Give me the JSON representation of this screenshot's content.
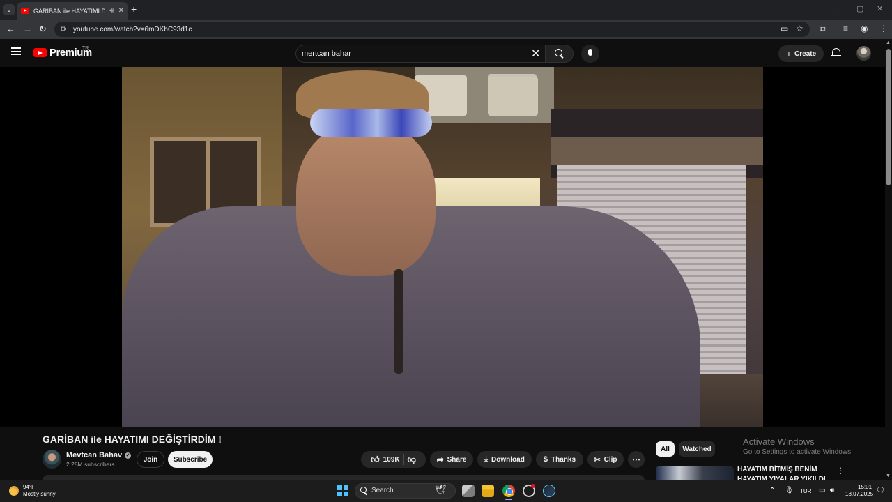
{
  "browser": {
    "tab_title": "GARİBAN ile HAYATIMI DEĞİŞTİRDİM !",
    "url": "youtube.com/watch?v=6mDKbC93d1c"
  },
  "youtube": {
    "logo_text": "Premium",
    "country": "TR",
    "search_value": "mertcan bahar",
    "create_label": "Create"
  },
  "video": {
    "title": "GARİBAN ile HAYATIMI DEĞİŞTİRDİM !",
    "channel": "Mevtcan Bahav",
    "subscribers": "2.28M subscribers",
    "join_label": "Join",
    "subscribe_label": "Subscribe",
    "likes": "109K",
    "share_label": "Share",
    "download_label": "Download",
    "thanks_label": "Thanks",
    "clip_label": "Clip",
    "more_label": "⋯"
  },
  "sidebar": {
    "chips": [
      "All",
      "Watched"
    ],
    "rec_title": "HAYATIM BİTMİŞ BENİM HAYATIM YIYALAR YIKILDI"
  },
  "watermark": {
    "title": "Activate Windows",
    "subtitle": "Go to Settings to activate Windows."
  },
  "taskbar": {
    "temperature": "94°F",
    "weather": "Mostly sunny",
    "search_label": "Search",
    "language": "TUR",
    "time": "15:01",
    "date": "18.07.2025"
  },
  "colors": {
    "youtube_red": "#ff0000",
    "background": "#0f0f0f",
    "chip_active": "#f1f1f1",
    "win_start": "#4cc2ff"
  }
}
